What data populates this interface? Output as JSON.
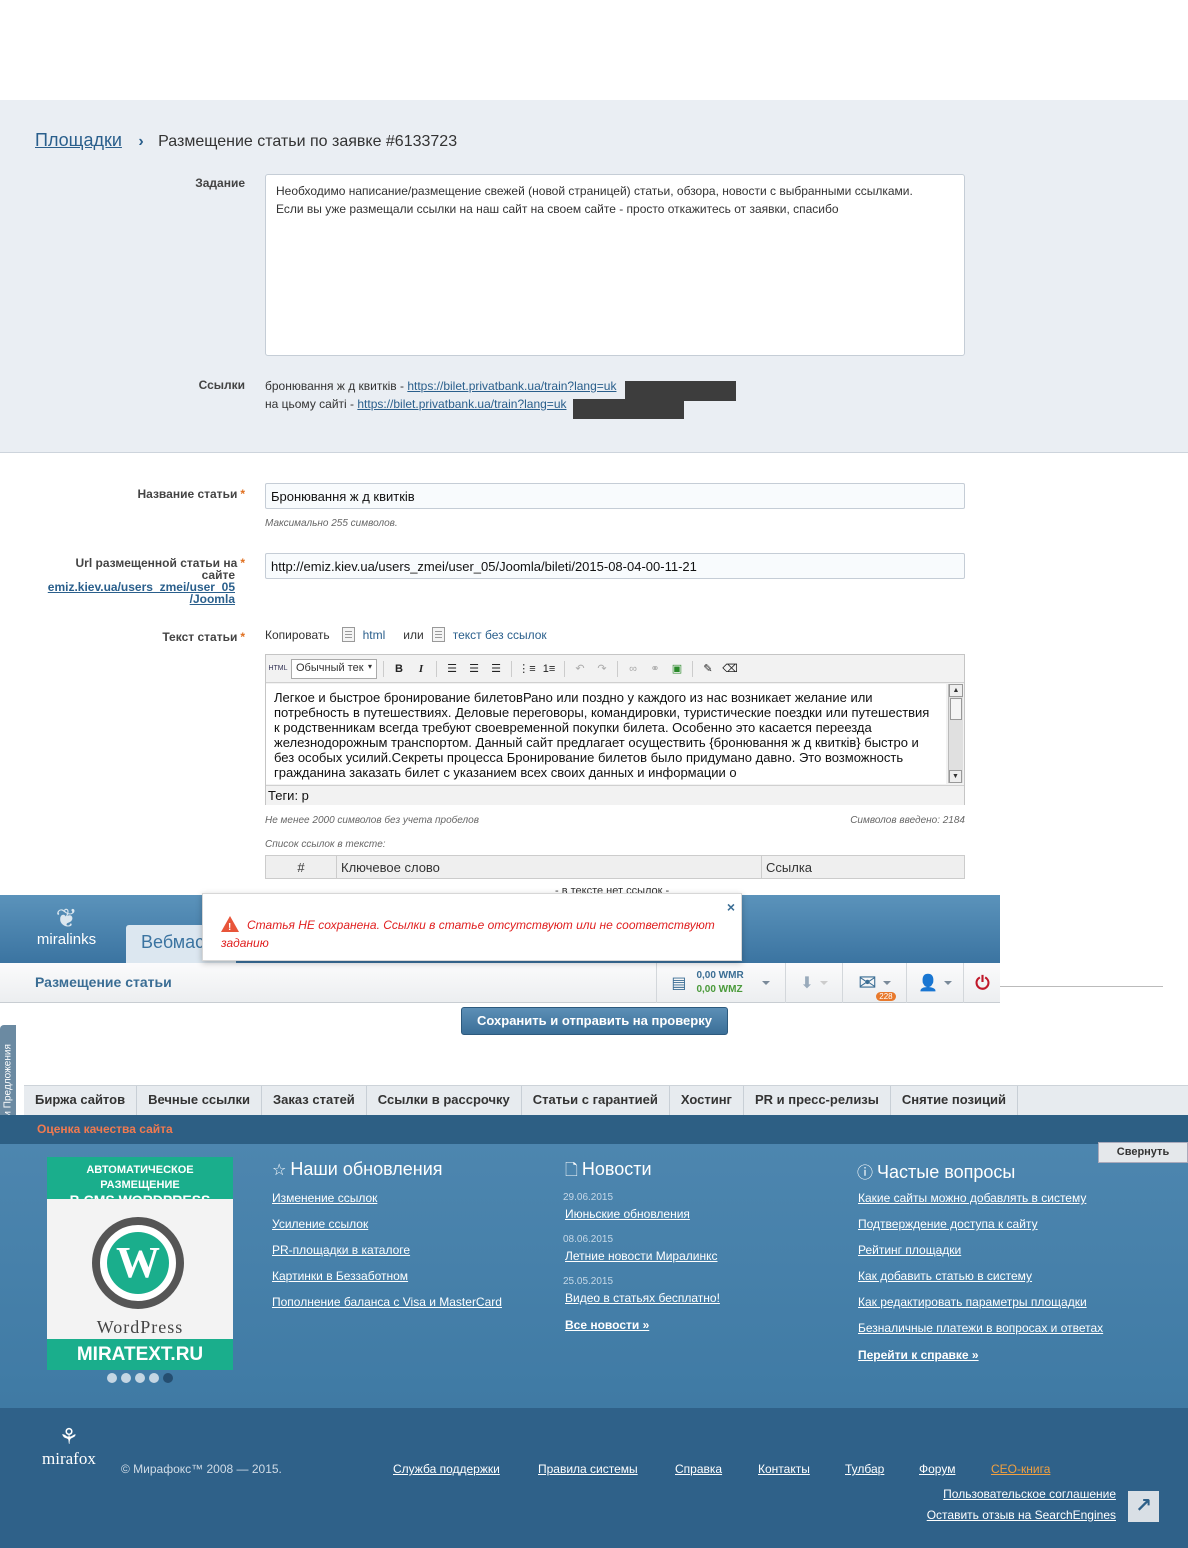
{
  "breadcrumb": {
    "root": "Площадки",
    "current": "Размещение статьи по заявке #6133723"
  },
  "task": {
    "label": "Задание",
    "lines": [
      "Необходимо написание/размещение свежей (новой страницей) статьи, обзора, новости с выбранными ссылками.",
      "Если вы уже размещали ссылки на наш сайт на своем сайте - просто откажитесь от заявки, спасибо"
    ]
  },
  "links": {
    "label": "Ссылки",
    "items": [
      {
        "prefix": "бронювання ж д квитків - ",
        "url": "https://bilet.privatbank.ua/train?lang=uk"
      },
      {
        "prefix": "на цьому сайті - ",
        "url": "https://bilet.privatbank.ua/train?lang=uk"
      }
    ]
  },
  "article_title": {
    "label": "Название статьи",
    "value": "Бронювання ж д квитків",
    "hint": "Максимально 255 символов."
  },
  "article_url": {
    "label_line1": "Url размещенной статьи на",
    "label_line2": "сайте",
    "site_link_1": "emiz.kiev.ua/users_zmei/user_05",
    "site_link_2": "/Joomla",
    "value": "http://emiz.kiev.ua/users_zmei/user_05/Joomla/bileti/2015-08-04-00-11-21"
  },
  "article_text": {
    "label": "Текст статьи",
    "copy_label": "Копировать",
    "copy_html": "html",
    "copy_or": "или",
    "copy_plain": "текст без ссылок",
    "format_select": "Обычный тек",
    "body": "Легкое и быстрое бронирование билетовРано или поздно у каждого из нас возникает желание или потребность в путешествиях. Деловые переговоры, командировки, туристические поездки или путешествия к родственникам всегда требуют своевременной покупки билета. Особенно это касается переезда железнодорожным транспортом. Данный сайт предлагает осуществить {бронювання ж д квитків} быстро и без особых усилий.Секреты процесса Бронирование билетов было придумано давно. Это возможность гражданина заказать билет с указанием всех своих данных и информации о",
    "status": "Теги: p",
    "min_hint": "Не менее 2000 символов без учета пробелов",
    "count_hint": "Символов введено: 2184"
  },
  "links_table": {
    "caption": "Список ссылок в тексте:",
    "headers": [
      "#",
      "Ключевое слово",
      "Ссылка"
    ],
    "empty": "- в тексте нет ссылок -"
  },
  "header": {
    "logo": "miralinks",
    "tab": "Вебмас",
    "section_title": "Размещение статьи",
    "wmr": "0,00 WMR",
    "wmz": "0,00 WMZ",
    "mail_count": "228"
  },
  "alert": {
    "text": "Статья НЕ сохранена. Ссылки в статье отсутствуют или не соответствуют заданию",
    "close": "×"
  },
  "save_button": "Сохранить и отправить на проверку",
  "feedback_tab": "Отзывы и Предложения",
  "nav": [
    "Биржа сайтов",
    "Вечные ссылки",
    "Заказ статей",
    "Ссылки в рассрочку",
    "Статьи с гарантией",
    "Хостинг",
    "PR и пресс-релизы",
    "Снятие позиций"
  ],
  "quality": "Оценка качества сайта",
  "collapse": "Свернуть",
  "banner": {
    "line1": "АВТОМАТИЧЕСКОЕ РАЗМЕЩЕНИЕ",
    "line2": "В CMS WORDPRESS",
    "wp_word": "WordPress",
    "bottom": "MIRATEXT.RU"
  },
  "updates": {
    "title": "Наши обновления",
    "items": [
      "Изменение ссылок",
      "Усиление ссылок",
      "PR-площадки в каталоге",
      "Картинки в Беззаботном",
      "Пополнение баланса с Visa и MasterCard"
    ]
  },
  "news": {
    "title": "Новости",
    "items": [
      {
        "date": "29.06.2015",
        "text": "Июньские обновления"
      },
      {
        "date": "08.06.2015",
        "text": "Летние новости Миралинкс"
      },
      {
        "date": "25.05.2015",
        "text": "Видео в статьях бесплатно!"
      }
    ],
    "all": "Все новости »"
  },
  "faq": {
    "title": "Частые вопросы",
    "items": [
      "Какие сайты можно добавлять в систему",
      "Подтверждение доступа к сайту",
      "Рейтинг площадки",
      "Как добавить статью в систему",
      "Как редактировать параметры площадки",
      "Безналичные платежи в вопросах и ответах"
    ],
    "all": "Перейти к справке »"
  },
  "footer": {
    "brand": "mirafox",
    "copyright": "© Мирафокс™ 2008 — 2015.",
    "links": [
      "Служба поддержки",
      "Правила системы",
      "Справка",
      "Контакты",
      "Тулбар",
      "Форум",
      "СЕО-книга"
    ],
    "agreement": "Пользовательское соглашение",
    "review": "Оставить отзыв на SearchEngines"
  },
  "colors": {
    "accent": "#2a5f8c",
    "header": "#3b74a1",
    "alert": "#e02020",
    "required": "#e07020",
    "banner": "#1aae8c"
  }
}
